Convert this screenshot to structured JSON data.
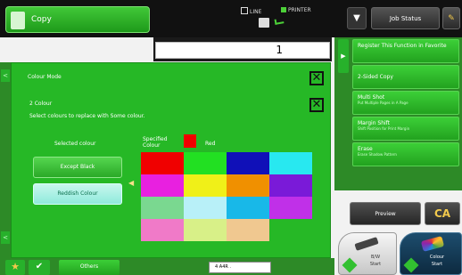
{
  "header": {
    "mode_label": "Copy",
    "line_label": "LINE",
    "printer_label": "PRINTER",
    "dropdown_arrow": "▼",
    "job_status_label": "Job Status",
    "tool_icon": "wrench-icon"
  },
  "copies": {
    "value": "1"
  },
  "right_panel": {
    "tab_arrow": "▶",
    "items": [
      {
        "title": "Register This Function in Favorite",
        "subtitle": ""
      },
      {
        "title": "2-Sided Copy",
        "subtitle": ""
      },
      {
        "title": "Multi Shot",
        "subtitle": "Put Multiple Pages in A Page"
      },
      {
        "title": "Margin Shift",
        "subtitle": "Shift Position for Print Margin"
      },
      {
        "title": "Erase",
        "subtitle": "Erase Shadow Pattern"
      }
    ],
    "preview_label": "Preview",
    "ca_label": "CA"
  },
  "start": {
    "bw_label_1": "B/W",
    "bw_label_2": "Start",
    "colour_label_1": "Colour",
    "colour_label_2": "Start"
  },
  "left_tab_arrow": "<",
  "bottom": {
    "star_icon": "★",
    "check_icon": "✔",
    "others_label": "Others",
    "paper_indicator": "4   A4R   ."
  },
  "dialog": {
    "title": "Colour Mode",
    "close_glyph": "✕",
    "two_colour_label": "2 Colour",
    "instruction": "Select colours to replace with Some colour.",
    "selected_colour_label": "Selected colour",
    "except_black_label": "Except Black",
    "reddish_label": "Reddish Colour",
    "arrow_glyph": "◀",
    "specified_label": "Specified Colour",
    "specified_name": "Red",
    "specified_color": "#f00000",
    "palette": [
      "#f00000",
      "#22e022",
      "#1010b8",
      "#28e8f0",
      "#e820e0",
      "#f0f018",
      "#f09000",
      "#7a1ad8",
      "#7ad890",
      "#b8f0f8",
      "#18b8e8",
      "#c030e8",
      "#f07ac8",
      "#d8f088",
      "#f0c890",
      "#26b826"
    ]
  },
  "colors": {
    "accent_green": "#26b826",
    "top_bar": "#111111",
    "panel_green": "#2d8a27"
  }
}
